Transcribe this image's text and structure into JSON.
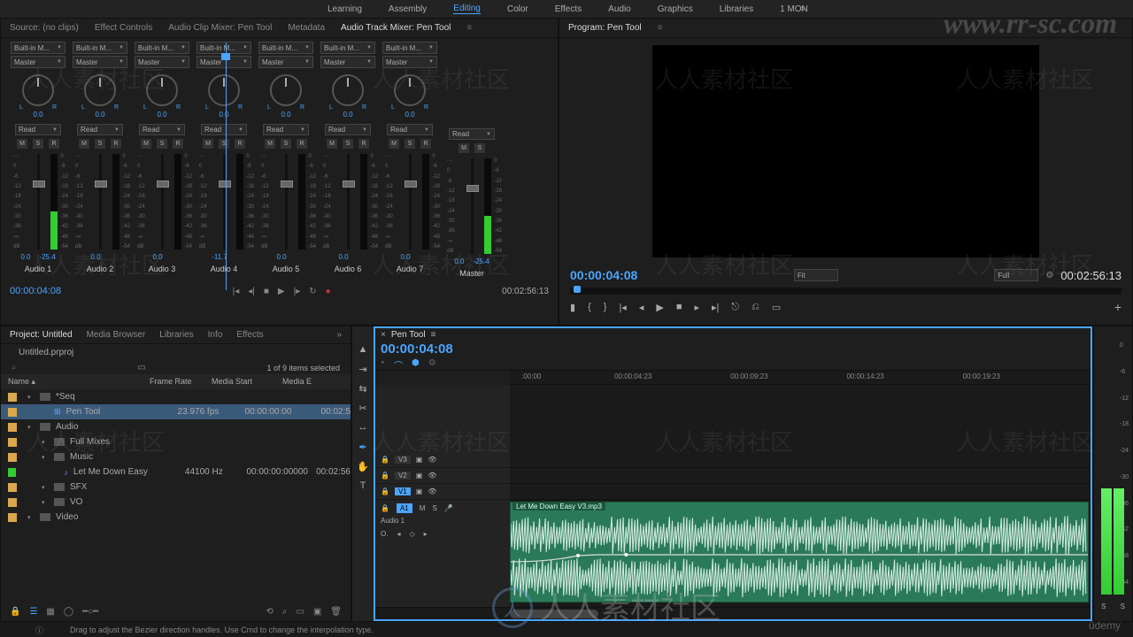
{
  "workspaces": [
    "Learning",
    "Assembly",
    "Editing",
    "Color",
    "Effects",
    "Audio",
    "Graphics",
    "Libraries",
    "1 MON"
  ],
  "workspace_active": "Editing",
  "source_tabs": [
    "Source: (no clips)",
    "Effect Controls",
    "Audio Clip Mixer: Pen Tool",
    "Metadata",
    "Audio Track Mixer: Pen Tool"
  ],
  "source_tab_active": "Audio Track Mixer: Pen Tool",
  "mixer": {
    "channels": [
      {
        "input": "Built-in M...",
        "bus": "Master",
        "pan": "0.0",
        "mode": "Read",
        "fader": "0.0",
        "peak": "-25.4",
        "label": "Audio 1",
        "meter": 40
      },
      {
        "input": "Built-in M...",
        "bus": "Master",
        "pan": "0.0",
        "mode": "Read",
        "fader": "0.0",
        "peak": "",
        "label": "Audio 2",
        "meter": 0
      },
      {
        "input": "Built-in M...",
        "bus": "Master",
        "pan": "0.0",
        "mode": "Read",
        "fader": "0.0",
        "peak": "",
        "label": "Audio 3",
        "meter": 0
      },
      {
        "input": "Built-in M...",
        "bus": "Master",
        "pan": "0.0",
        "mode": "Read",
        "fader": "-11.7",
        "peak": "",
        "label": "Audio 4",
        "meter": 0
      },
      {
        "input": "Built-in M...",
        "bus": "Master",
        "pan": "0.0",
        "mode": "Read",
        "fader": "0.0",
        "peak": "",
        "label": "Audio 5",
        "meter": 0
      },
      {
        "input": "Built-in M...",
        "bus": "Master",
        "pan": "0.0",
        "mode": "Read",
        "fader": "0.0",
        "peak": "",
        "label": "Audio 6",
        "meter": 0
      },
      {
        "input": "Built-in M...",
        "bus": "Master",
        "pan": "0.0",
        "mode": "Read",
        "fader": "0.0",
        "peak": "",
        "label": "Audio 7",
        "meter": 0
      }
    ],
    "master": {
      "mode": "Read",
      "fader": "0.0",
      "peak": "-25.4",
      "label": "Master",
      "meter": 40
    },
    "scale": [
      "- -",
      "0",
      "-6",
      "-12",
      "-18",
      "-24",
      "-30",
      "-36",
      "-∞",
      "dB"
    ],
    "scale_r": [
      "0",
      "-6",
      "-12",
      "-18",
      "-24",
      "-30",
      "-36",
      "-42",
      "-48",
      "-54"
    ],
    "lr": {
      "L": "L",
      "R": "R"
    },
    "ms": {
      "M": "M",
      "S": "S",
      "R": "R",
      "rec": "●"
    },
    "tc_in": "00:00:04:08",
    "tc_out": "00:02:56:13"
  },
  "program": {
    "title": "Program: Pen Tool",
    "tc_in": "00:00:04:08",
    "fit": "Fit",
    "full": "Full",
    "tc_out": "00:02:56:13"
  },
  "project": {
    "tabs": [
      "Project: Untitled",
      "Media Browser",
      "Libraries",
      "Info",
      "Effects"
    ],
    "file": "Untitled.prproj",
    "sel_count": "1 of 9 items selected",
    "headers": {
      "name": "Name",
      "fr": "Frame Rate",
      "ms": "Media Start",
      "me": "Media E"
    },
    "items": [
      {
        "indent": 0,
        "type": "bin",
        "name": "*Seq",
        "fr": "",
        "ms": "",
        "me": ""
      },
      {
        "indent": 1,
        "type": "seq",
        "name": "Pen Tool",
        "fr": "23.976 fps",
        "ms": "00:00:00:00",
        "me": "00:02:5",
        "sel": true
      },
      {
        "indent": 0,
        "type": "bin",
        "name": "Audio",
        "fr": "",
        "ms": "",
        "me": ""
      },
      {
        "indent": 1,
        "type": "bin",
        "name": "Full Mixes",
        "fr": "",
        "ms": "",
        "me": ""
      },
      {
        "indent": 1,
        "type": "bin",
        "name": "Music",
        "fr": "",
        "ms": "",
        "me": ""
      },
      {
        "indent": 2,
        "type": "audio",
        "name": "Let Me Down Easy",
        "fr": "44100 Hz",
        "ms": "00:00:00:00000",
        "me": "00:02:56",
        "green": true
      },
      {
        "indent": 1,
        "type": "bin",
        "name": "SFX",
        "fr": "",
        "ms": "",
        "me": ""
      },
      {
        "indent": 1,
        "type": "bin",
        "name": "VO",
        "fr": "",
        "ms": "",
        "me": ""
      },
      {
        "indent": 0,
        "type": "bin",
        "name": "Video",
        "fr": "",
        "ms": "",
        "me": ""
      }
    ]
  },
  "timeline": {
    "tab": "Pen Tool",
    "tc": "00:00:04:08",
    "ruler": [
      {
        "pos": 2,
        "t": ":00:00"
      },
      {
        "pos": 18,
        "t": "00:00:04:23"
      },
      {
        "pos": 38,
        "t": "00:00:09:23"
      },
      {
        "pos": 58,
        "t": "00:00:14:23"
      },
      {
        "pos": 78,
        "t": "00:00:19:23"
      }
    ],
    "tracks": {
      "v": [
        {
          "id": "V3"
        },
        {
          "id": "V2"
        },
        {
          "id": "V1",
          "sel": true
        }
      ],
      "a": [
        {
          "id": "A1",
          "name": "Audio 1",
          "sel": true
        }
      ]
    },
    "clip_name": "Let Me Down Easy V3.mp3",
    "audio_ctrl": {
      "M": "M",
      "S": "S",
      "O": "O.",
      "zero": "0."
    }
  },
  "levels": {
    "scale": [
      "0",
      "-6",
      "-12",
      "-18",
      "-24",
      "-30",
      "-36",
      "-42",
      "-48",
      "-54"
    ],
    "labels": {
      "S": "S",
      "S2": "S"
    }
  },
  "status": "Drag to adjust the Bezier direction handles. Use Cmd to change the interpolation type.",
  "watermarks": {
    "url": "www.rr-sc.com",
    "cn": "人人素材社区",
    "udemy": "ûdemy"
  }
}
